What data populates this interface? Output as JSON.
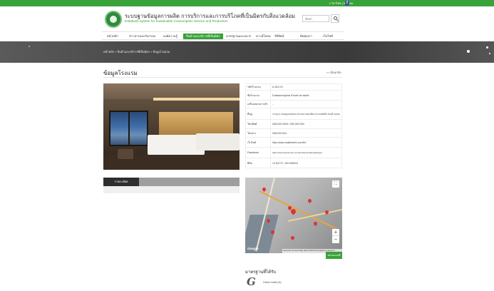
{
  "topbar": {
    "links": "ภาษาไทย | English",
    "facebook_label": "Facebook",
    "facebook_glyph": "f"
  },
  "header": {
    "site_title": "ระบบฐานข้อมูลการผลิต การบริการและการบริโภคที่เป็นมิตรกับสิ่งแวดล้อม",
    "site_subtitle": "Database system for Sustainable Consumption Service and Production",
    "search_placeholder": "ค้นหา"
  },
  "nav": {
    "items": [
      {
        "label": "หน้าหลัก",
        "active": false
      },
      {
        "label": "ข่าวสารและกิจกรรม",
        "active": false
      },
      {
        "label": "องค์ความรู้",
        "active": false
      },
      {
        "label": "สินค้าและบริการที่เป็นมิตร",
        "active": true
      },
      {
        "label": "มาตรฐานและฉลาก",
        "active": false
      },
      {
        "label": "ดาวน์โหลด",
        "active": false
      },
      {
        "label": "วิดีทัศน์",
        "active": false
      },
      {
        "label": "ติดต่อเรา",
        "active": false
      },
      {
        "label": "เว็บไซต์",
        "active": false
      }
    ]
  },
  "breadcrumb": "หน้าหลัก » สินค้าและบริการที่เป็นมิตร » ข้อมูลโรงแรม",
  "page": {
    "title": "ข้อมูลโรงแรม",
    "back_link": "<< ย้อนกลับ"
  },
  "info": {
    "rows": [
      {
        "label": "รหัสโรงแรม",
        "value": "A-DIG-01"
      },
      {
        "label": "ชื่อโรงแรม",
        "value": "Dusitaworaphat d'hotel de lalalin"
      },
      {
        "label": "เครื่องหมายการค้า",
        "value": "-"
      },
      {
        "label": "ที่อยู่",
        "value": "72 หมู่ 5 ถนนบูลเลอร์แมน ตำบลนาจอมเทียน อำเภอสัตหีบ ชลบุรี 20150"
      },
      {
        "label": "โทรศัพท์",
        "value": "038-000-0000, 038-000-000"
      },
      {
        "label": "โทรสาร",
        "value": "038-000-001"
      },
      {
        "label": "เว็บไซต์",
        "value": "http://www.dusithotels.com/th/"
      },
      {
        "label": "Facebook",
        "value": "https://www.facebook.com/dusitdevaraphatpattaya/"
      },
      {
        "label": "พิกัด",
        "value": "12.84772, 100.906513"
      }
    ]
  },
  "tabs": {
    "active_label": "รายละเอียด"
  },
  "map": {
    "fullscreen_glyph": "⛶",
    "zoom_in": "+",
    "zoom_out": "−",
    "google_label": "Google",
    "attribution": "Keyboard shortcuts  Map data ©2023  Terms  Report a map error",
    "button_label": "ขยายแผนที่"
  },
  "standards": {
    "title": "มาตรฐานที่ได้รับ",
    "logo_glyph": "G",
    "label": "Green Hotel (G)"
  },
  "colors": {
    "brand_green": "#3aa23a",
    "tab_active": "#2e2e2e",
    "facebook": "#3b5998"
  }
}
